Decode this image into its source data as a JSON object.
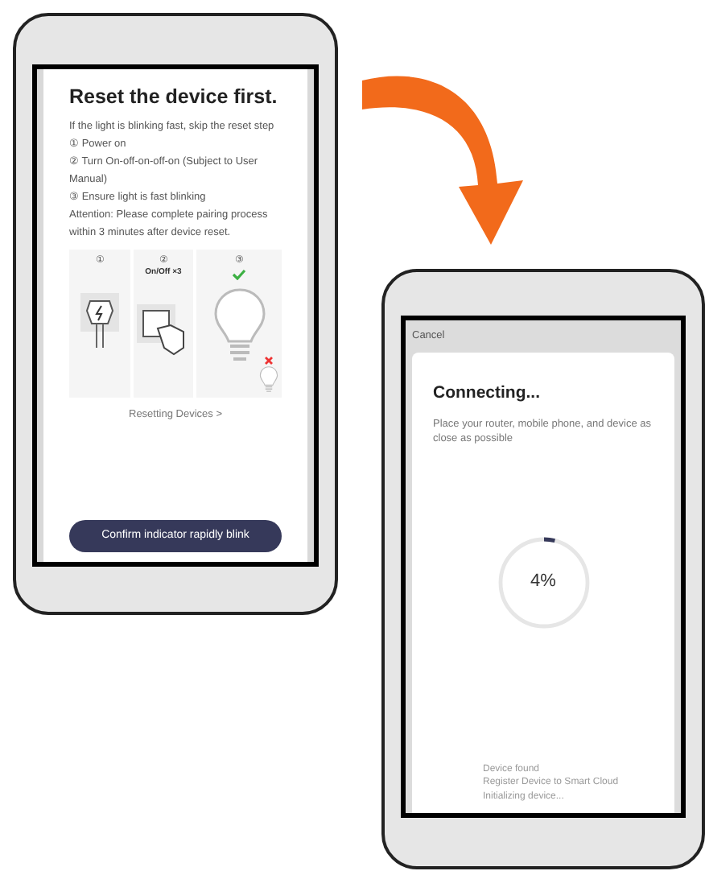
{
  "reset_screen": {
    "title": "Reset the device first.",
    "intro": "If the light is blinking fast, skip the reset step",
    "steps": [
      {
        "number": "①",
        "text": "Power on"
      },
      {
        "number": "②",
        "text": "Turn On-off-on-off-on (Subject to User Manual)"
      },
      {
        "number": "③",
        "text": "Ensure light is fast blinking"
      }
    ],
    "attention": "Attention: Please complete pairing process within 3 minutes after device reset.",
    "illustration": [
      {
        "kind": "plug",
        "number": "①"
      },
      {
        "kind": "switch",
        "number": "②",
        "caption": "On/Off ×3"
      },
      {
        "kind": "bulb",
        "number": "③"
      }
    ],
    "link": "Resetting Devices >",
    "button": "Confirm indicator rapidly blink"
  },
  "connecting_screen": {
    "cancel": "Cancel",
    "title": "Connecting...",
    "subtitle": "Place your router, mobile phone, and device as close as possible",
    "progress": {
      "level": 0.04,
      "reading": "4%"
    },
    "status_lines": [
      "Device found",
      "Register Device to Smart Cloud",
      "Initializing device..."
    ]
  }
}
